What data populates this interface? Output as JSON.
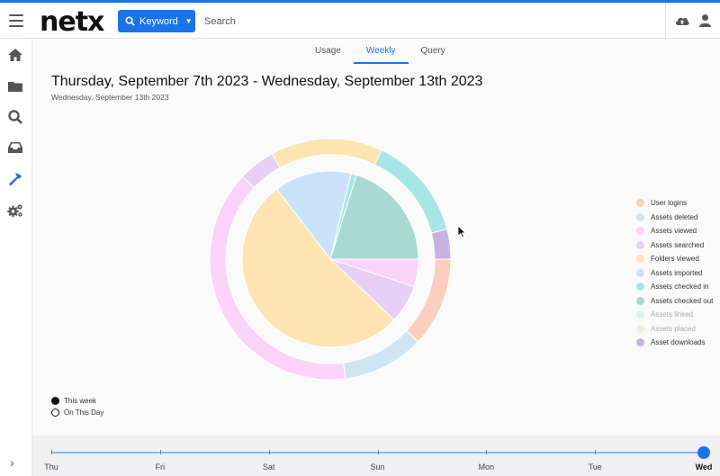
{
  "app": {
    "logo_text": "netx"
  },
  "search": {
    "keyword_label": "Keyword",
    "placeholder": "Search"
  },
  "tabs": [
    {
      "label": "Usage",
      "active": false
    },
    {
      "label": "Weekly",
      "active": true
    },
    {
      "label": "Query",
      "active": false
    }
  ],
  "report": {
    "title": "Thursday, September 7th 2023 - Wednesday, September 13th 2023",
    "subtitle": "Wednesday, September 13th 2023"
  },
  "chart_data": {
    "type": "pie",
    "series": [
      {
        "name": "This week",
        "labels": [
          "User logins",
          "Assets deleted",
          "Assets viewed",
          "Assets searched",
          "Folders viewed",
          "Assets imported",
          "Assets checked in",
          "Assets checked out",
          "Assets linked",
          "Assets placed",
          "Asset downloads"
        ],
        "values": [
          12,
          11,
          39,
          5,
          15,
          0,
          14,
          0,
          0,
          0,
          4
        ]
      },
      {
        "name": "On This Day",
        "labels": [
          "User logins",
          "Assets deleted",
          "Assets viewed",
          "Assets searched",
          "Folders viewed",
          "Assets imported",
          "Assets checked in",
          "Assets checked out",
          "Assets linked",
          "Assets placed",
          "Asset downloads"
        ],
        "values": [
          0,
          0,
          5,
          7,
          52,
          14,
          1,
          20,
          0,
          0,
          0
        ]
      }
    ],
    "colors": [
      "#fbcfc0",
      "#cfe6f2",
      "#fbd3f8",
      "#e7d0f6",
      "#fde4b0",
      "#c9e2f9",
      "#a8e6e6",
      "#a9d9d3",
      "#d8f3e4",
      "#e4f2dc",
      "#c6b1e0"
    ]
  },
  "legend": [
    {
      "label": "User logins",
      "color": "#fbcfc0",
      "muted": false
    },
    {
      "label": "Assets deleted",
      "color": "#cfe6f2",
      "muted": false
    },
    {
      "label": "Assets viewed",
      "color": "#fbd3f8",
      "muted": false
    },
    {
      "label": "Assets searched",
      "color": "#e7d0f6",
      "muted": false
    },
    {
      "label": "Folders viewed",
      "color": "#fde4b0",
      "muted": false
    },
    {
      "label": "Assets imported",
      "color": "#c9e2f9",
      "muted": false
    },
    {
      "label": "Assets checked in",
      "color": "#a8e6e6",
      "muted": false
    },
    {
      "label": "Assets checked out",
      "color": "#a9d9d3",
      "muted": false
    },
    {
      "label": "Assets linked",
      "color": "#d8f3e4",
      "muted": true
    },
    {
      "label": "Assets placed",
      "color": "#e4f2dc",
      "muted": true
    },
    {
      "label": "Asset downloads",
      "color": "#c6b1e0",
      "muted": false
    }
  ],
  "week_legend": {
    "this_week": "This week",
    "on_this_day": "On This Day"
  },
  "timeline": {
    "days": [
      "Thu",
      "Fri",
      "Sat",
      "Sun",
      "Mon",
      "Tue",
      "Wed"
    ],
    "selected_index": 6
  },
  "icons": {
    "menu": "hamburger-icon",
    "search": "search-icon",
    "upload": "cloud-upload-icon",
    "user": "user-icon",
    "home": "home-icon",
    "folder": "folder-icon",
    "inbox": "inbox-icon",
    "tools": "hammer-icon",
    "settings": "gears-icon",
    "expand": "chevron-right-icon"
  }
}
